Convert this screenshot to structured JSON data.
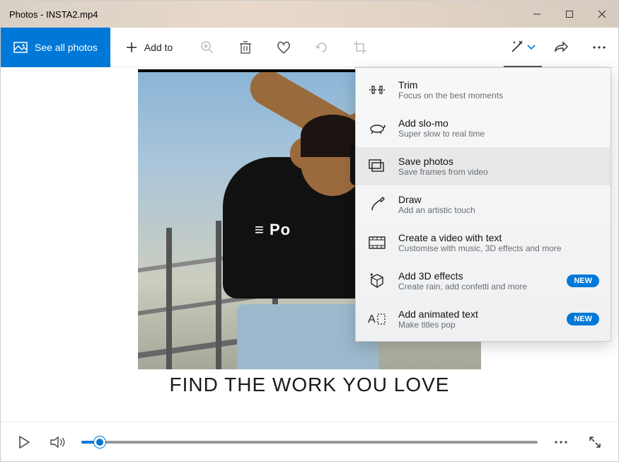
{
  "window": {
    "title": "Photos - INSTA2.mp4"
  },
  "toolbar": {
    "see_all": "See all photos",
    "add_to": "Add to"
  },
  "caption": "FIND THE WORK YOU LOVE",
  "shirt_text": "≡ Po",
  "dropdown": {
    "items": [
      {
        "title": "Trim",
        "sub": "Focus on the best moments",
        "icon": "trim-icon",
        "badge": ""
      },
      {
        "title": "Add slo-mo",
        "sub": "Super slow to real time",
        "icon": "turtle-icon",
        "badge": ""
      },
      {
        "title": "Save photos",
        "sub": "Save frames from video",
        "icon": "save-frames-icon",
        "badge": ""
      },
      {
        "title": "Draw",
        "sub": "Add an artistic touch",
        "icon": "draw-icon",
        "badge": ""
      },
      {
        "title": "Create a video with text",
        "sub": "Customise with music, 3D effects and more",
        "icon": "film-text-icon",
        "badge": ""
      },
      {
        "title": "Add 3D effects",
        "sub": "Create rain, add confetti and more",
        "icon": "3d-effects-icon",
        "badge": "NEW"
      },
      {
        "title": "Add animated text",
        "sub": "Make titles pop",
        "icon": "animated-text-icon",
        "badge": "NEW"
      }
    ]
  },
  "playback": {
    "progress_pct": 4
  }
}
